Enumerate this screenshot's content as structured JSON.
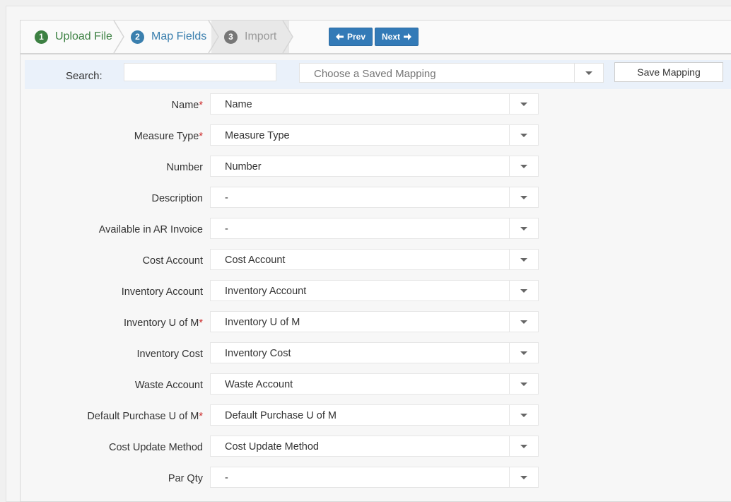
{
  "wizard": {
    "steps": [
      {
        "num": "1",
        "label": "Upload File"
      },
      {
        "num": "2",
        "label": "Map Fields"
      },
      {
        "num": "3",
        "label": "Import"
      }
    ],
    "prev_label": "Prev",
    "next_label": "Next"
  },
  "search": {
    "label": "Search:",
    "value": "",
    "saved_mapping_placeholder": "Choose a Saved Mapping",
    "save_mapping_label": "Save Mapping"
  },
  "fields": [
    {
      "label": "Name",
      "required": "*",
      "value": "Name"
    },
    {
      "label": "Measure Type",
      "required": "*",
      "value": "Measure Type"
    },
    {
      "label": "Number",
      "required": "",
      "value": "Number"
    },
    {
      "label": "Description",
      "required": "",
      "value": "-"
    },
    {
      "label": "Available in AR Invoice",
      "required": "",
      "value": "-"
    },
    {
      "label": "Cost Account",
      "required": "",
      "value": "Cost Account"
    },
    {
      "label": "Inventory Account",
      "required": "",
      "value": "Inventory Account"
    },
    {
      "label": "Inventory U of M",
      "required": "*",
      "value": "Inventory U of M"
    },
    {
      "label": "Inventory Cost",
      "required": "",
      "value": "Inventory Cost"
    },
    {
      "label": "Waste Account",
      "required": "",
      "value": "Waste Account"
    },
    {
      "label": "Default Purchase U of M",
      "required": "*",
      "value": "Default Purchase U of M"
    },
    {
      "label": "Cost Update Method",
      "required": "",
      "value": "Cost Update Method"
    },
    {
      "label": "Par Qty",
      "required": "",
      "value": "-"
    }
  ],
  "colors": {
    "step_done": "#3c8042",
    "step_active": "#3a7fae",
    "step_pending": "#777777",
    "primary_button": "#337ab7",
    "required_marker": "#cc2b2b",
    "search_bar_bg": "#eaf1fa"
  },
  "icons": {
    "prev": "arrow-left-icon",
    "next": "arrow-right-icon",
    "dropdown": "caret-down-icon"
  }
}
